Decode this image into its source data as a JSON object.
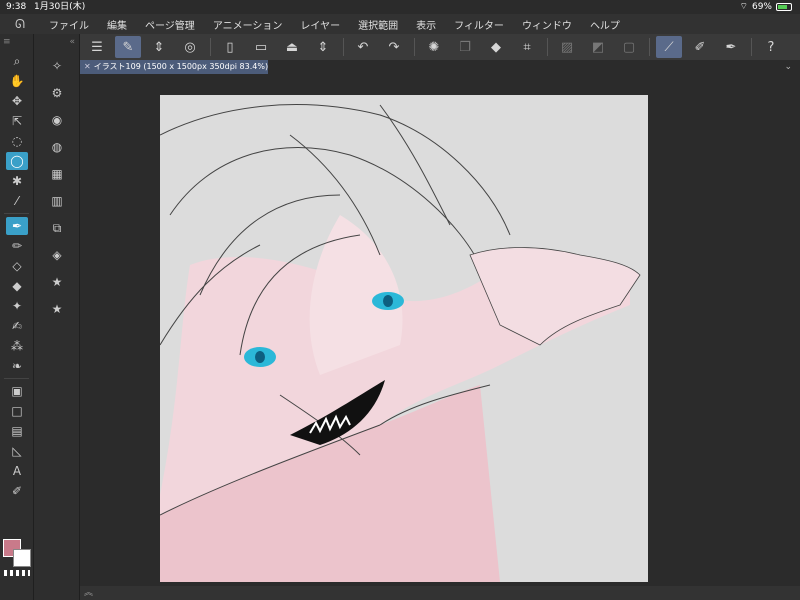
{
  "status": {
    "time": "9:38",
    "date": "1月30日(木)",
    "battery": "69%"
  },
  "menu": [
    "ファイル",
    "編集",
    "ページ管理",
    "アニメーション",
    "レイヤー",
    "選択範囲",
    "表示",
    "フィルター",
    "ウィンドウ",
    "ヘルプ"
  ],
  "tab": {
    "title": "イラスト109 (1500 x 1500px 350dpi 83.4%)"
  },
  "colors": {
    "foreground": "#c97a8a",
    "background": "#ffffff",
    "accent": "#3aa0c8"
  }
}
